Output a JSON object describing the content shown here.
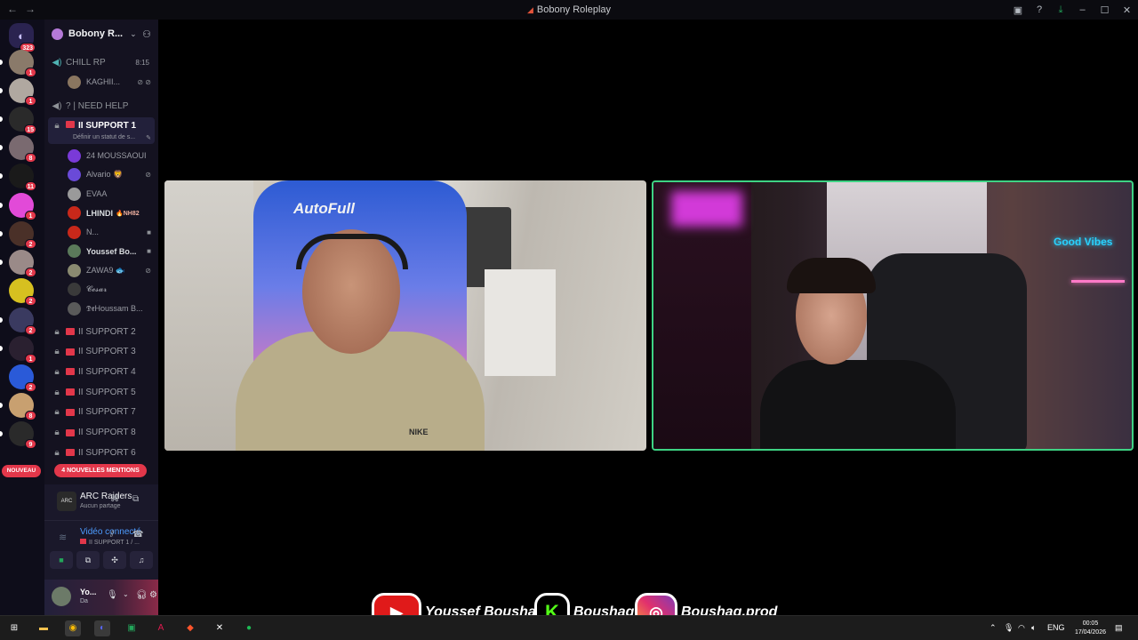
{
  "window": {
    "title": "Bobony Roleplay",
    "nav_back": "←",
    "nav_forward": "→"
  },
  "colors": {
    "accent_green": "#3ed384",
    "badge_red": "#e2374a",
    "connected_blue": "#4d9cff"
  },
  "rail": {
    "dm_badge": "323",
    "badges": [
      "1",
      "1",
      "15",
      "8",
      "11",
      "1",
      "2",
      "2",
      "2",
      "2",
      "1",
      "2",
      "8",
      "9"
    ],
    "nouveau_label": "NOUVEAU"
  },
  "server": {
    "name": "Bobony R...",
    "icon": "server-icon"
  },
  "channels": {
    "chill": {
      "label": "CHILL RP",
      "time": "8:15"
    },
    "chill_member": "KAGHII...",
    "need_help": "? | NEED HELP",
    "support1": {
      "label": "II SUPPORT 1",
      "status_hint": "Définir un statut de s..."
    },
    "members": [
      {
        "name": "24 MOUSSAOUI",
        "tag": ""
      },
      {
        "name": "Alvario 🦁",
        "tag": ""
      },
      {
        "name": "EVAA",
        "tag": ""
      },
      {
        "name": "LHINDI",
        "tag": "🔥NH82"
      },
      {
        "name": "N...",
        "tag": ""
      },
      {
        "name": "Youssef Bo...",
        "tag": ""
      },
      {
        "name": "ZAWA9 🐟",
        "tag": ""
      },
      {
        "name": "𝓒𝓮𝓼𝓪𝓻",
        "tag": ""
      },
      {
        "name": "𝕯𝖗Houssam B...",
        "tag": ""
      }
    ],
    "locked": [
      "II SUPPORT 2",
      "II SUPPORT 3",
      "II SUPPORT 4",
      "II SUPPORT 5",
      "II SUPPORT 7",
      "II SUPPORT 8",
      "II SUPPORT 6"
    ],
    "mentions_label": "4 NOUVELLES MENTIONS"
  },
  "activity": {
    "game": "ARC Raiders",
    "sub": "Aucun partage",
    "icon_text": "ARC"
  },
  "voice": {
    "status": "Vidéo connecté",
    "channel": "II SUPPORT 1 / ..."
  },
  "user": {
    "name": "Yo...",
    "sub": "Da"
  },
  "banner": {
    "youtube": "Youssef Boushaq",
    "kick": "Boushaq",
    "instagram": "Boushaq.prod"
  },
  "tiles": {
    "left_chair_text": "AutoFull",
    "left_shirt_logo": "NIKE",
    "right_neon": "Good Vibes"
  },
  "taskbar": {
    "lang": "ENG",
    "time": "00:05",
    "date": "17/04/2026"
  }
}
